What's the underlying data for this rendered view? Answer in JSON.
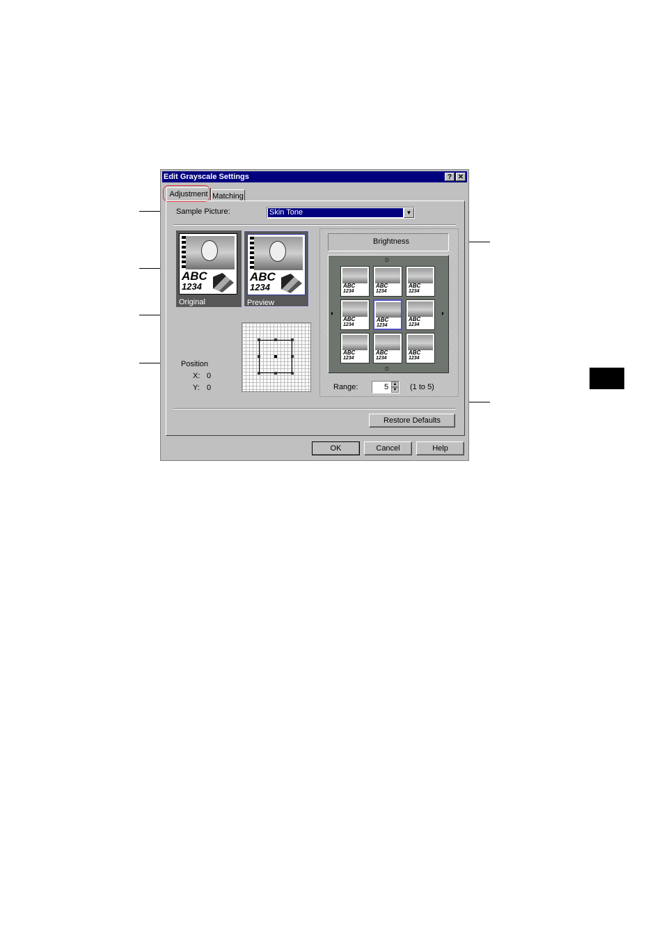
{
  "dialog": {
    "title": "Edit Grayscale Settings",
    "help_icon": "question-icon",
    "close_icon": "close-icon"
  },
  "tabs": [
    {
      "label": "Adjustment",
      "active": true
    },
    {
      "label": "Matching",
      "active": false
    }
  ],
  "sample_picture": {
    "label": "Sample Picture:",
    "value": "Skin Tone"
  },
  "thumbnails": {
    "original_caption": "Original",
    "preview_caption": "Preview",
    "abc_text": "ABC",
    "num_text": "1234"
  },
  "brightness": {
    "label": "Brightness",
    "range_label": "Range:",
    "range_value": "5",
    "range_hint": "(1 to 5)"
  },
  "position": {
    "label": "Position",
    "x_label": "X:",
    "x_value": "0",
    "y_label": "Y:",
    "y_value": "0"
  },
  "buttons": {
    "restore_defaults": "Restore Defaults",
    "ok": "OK",
    "cancel": "Cancel",
    "help": "Help"
  },
  "colors": {
    "title_bar": "#00007f",
    "dialog_face": "#c0c0c0",
    "highlight_circle": "#e0303a"
  }
}
